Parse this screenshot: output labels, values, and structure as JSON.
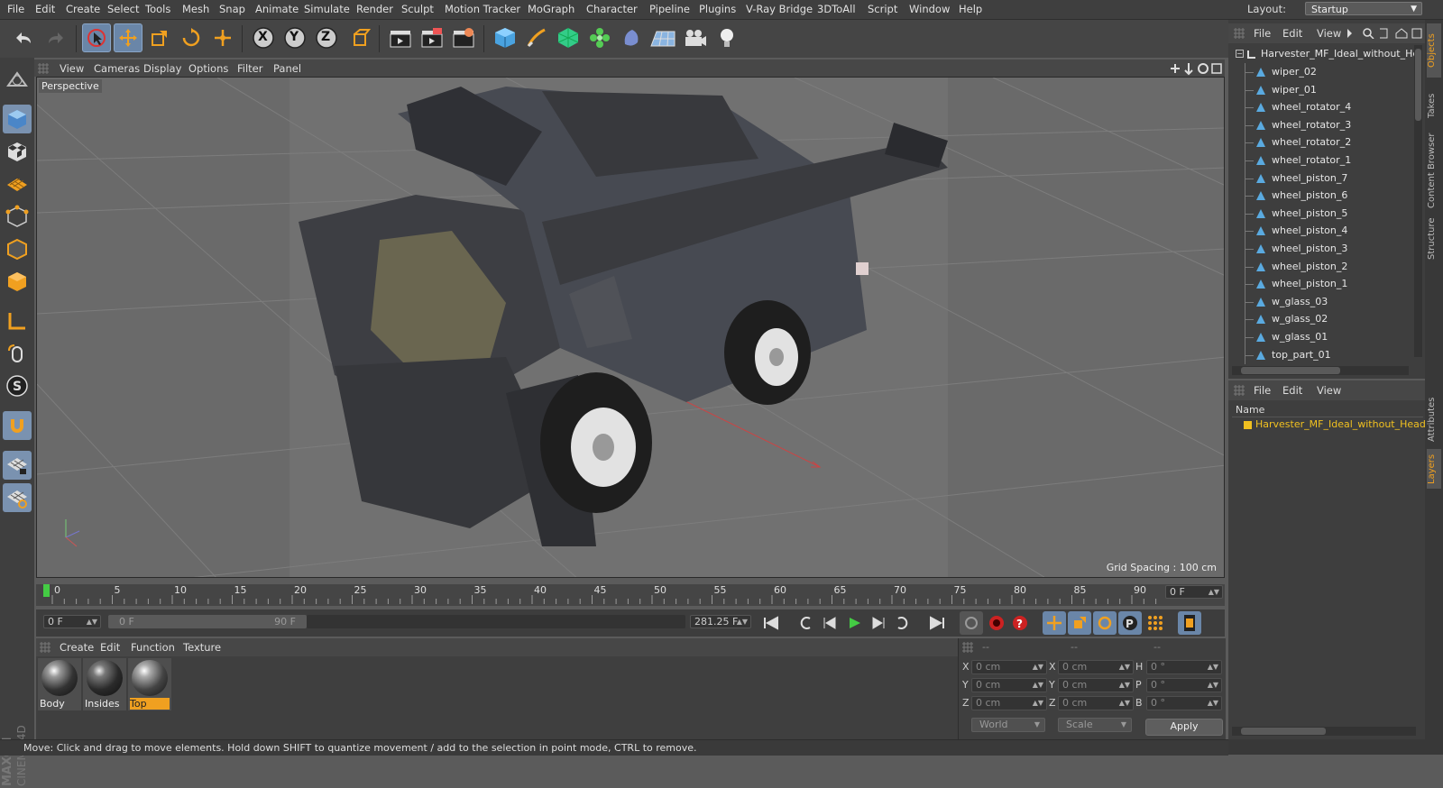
{
  "menu": [
    "File",
    "Edit",
    "Create",
    "Select",
    "Tools",
    "Mesh",
    "Snap",
    "Animate",
    "Simulate",
    "Render",
    "Sculpt",
    "Motion Tracker",
    "MoGraph",
    "Character",
    "Pipeline",
    "Plugins",
    "V-Ray Bridge",
    "3DToAll",
    "Script",
    "Window",
    "Help"
  ],
  "layout": {
    "label": "Layout:",
    "value": "Startup"
  },
  "toolbar": {
    "axis_x": "X",
    "axis_y": "Y",
    "axis_z": "Z"
  },
  "viewport": {
    "menu": [
      "View",
      "Cameras",
      "Display",
      "Options",
      "Filter",
      "Panel"
    ],
    "camera_label": "Perspective",
    "grid_spacing": "Grid Spacing : 100 cm"
  },
  "timeline": {
    "ticks": [
      "0",
      "5",
      "10",
      "15",
      "20",
      "25",
      "30",
      "35",
      "40",
      "45",
      "50",
      "55",
      "60",
      "65",
      "70",
      "75",
      "80",
      "85",
      "90"
    ],
    "end_field": "0 F",
    "start_field": "0 F",
    "range_start": "0 F",
    "range_end": "90 F",
    "current_frame": "281.25 F"
  },
  "materials": {
    "menu": [
      "Create",
      "Edit",
      "Function",
      "Texture"
    ],
    "items": [
      {
        "name": "Body"
      },
      {
        "name": "Insides"
      },
      {
        "name": "Top"
      }
    ]
  },
  "coordinates": {
    "header": [
      "--",
      "--",
      "--"
    ],
    "pos_x": "0 cm",
    "pos_y": "0 cm",
    "pos_z": "0 cm",
    "size_x": "0 cm",
    "size_y": "0 cm",
    "size_z": "0 cm",
    "rot_h": "0 °",
    "rot_p": "0 °",
    "rot_b": "0 °",
    "labels": {
      "x": "X",
      "y": "Y",
      "z": "Z",
      "h": "H",
      "p": "P",
      "b": "B"
    },
    "mode1": "World",
    "mode2": "Scale",
    "apply": "Apply"
  },
  "status": "Move: Click and drag to move elements. Hold down SHIFT to quantize movement / add to the selection in point mode, CTRL to remove.",
  "objects": {
    "menu": [
      "File",
      "Edit",
      "View"
    ],
    "root": "Harvester_MF_Ideal_without_He",
    "items": [
      "wiper_02",
      "wiper_01",
      "wheel_rotator_4",
      "wheel_rotator_3",
      "wheel_rotator_2",
      "wheel_rotator_1",
      "wheel_piston_7",
      "wheel_piston_6",
      "wheel_piston_5",
      "wheel_piston_4",
      "wheel_piston_3",
      "wheel_piston_2",
      "wheel_piston_1",
      "w_glass_03",
      "w_glass_02",
      "w_glass_01",
      "top_part_01"
    ]
  },
  "layers": {
    "menu": [
      "File",
      "Edit",
      "View"
    ],
    "column": "Name",
    "item": "Harvester_MF_Ideal_without_Head"
  },
  "right_tabs": [
    "Objects",
    "Takes",
    "Content Browser",
    "Structure",
    "Attributes",
    "Layers"
  ],
  "brand": "MAXON CINEMA 4D"
}
